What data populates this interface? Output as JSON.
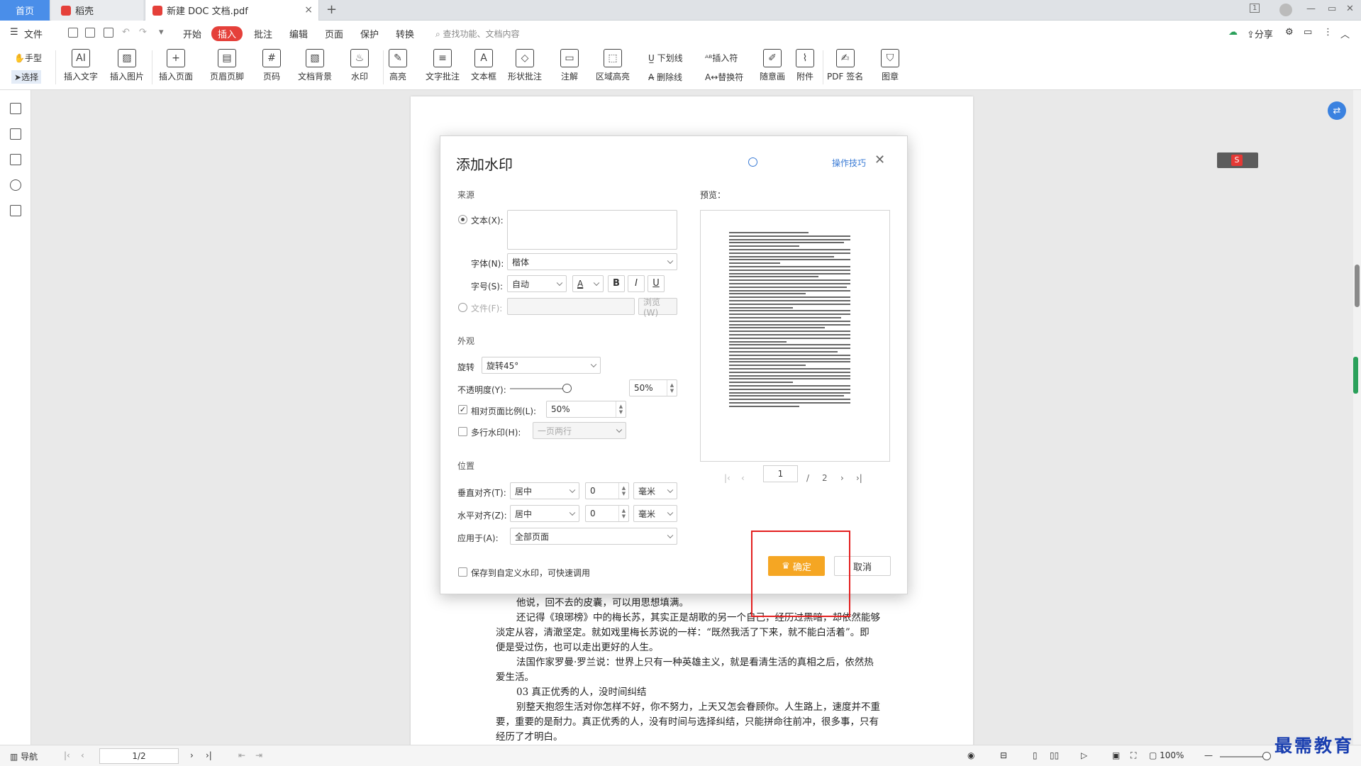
{
  "tabs": {
    "home": "首页",
    "daoke": "稻壳",
    "doc": "新建 DOC 文档.pdf",
    "close": "×",
    "plus": "+"
  },
  "window": {
    "pageview": "1",
    "minimize": "—",
    "restore": "▭",
    "close": "✕"
  },
  "menu": {
    "file": "文件",
    "items": [
      "开始",
      "插入",
      "批注",
      "编辑",
      "页面",
      "保护",
      "转换"
    ],
    "search_placeholder": "查找功能、文档内容",
    "share": "分享"
  },
  "ribbon": {
    "hand": "手型",
    "select": "选择",
    "buttons": [
      "插入文字",
      "插入图片",
      "插入页面",
      "页眉页脚",
      "页码",
      "文档背景",
      "水印",
      "高亮",
      "文字批注",
      "文本框",
      "形状批注",
      "注解",
      "区域高亮"
    ],
    "underline": "下划线",
    "strike": "删除线",
    "insert_char": "插入符",
    "replace_char": "替换符",
    "freehand": "随意画",
    "attach": "附件",
    "pdf_sign": "PDF 签名",
    "stamp": "图章"
  },
  "doc_lines": [
    "他说，回不去的皮囊，可以用思想填满。",
    "还记得《琅琊榜》中的梅长苏，其实正是胡歌的另一个自己，经历过黑暗，却依然能够",
    "淡定从容，清澈坚定。就如戏里梅长苏说的一样：“既然我活了下来，就不能白活着”。即",
    "便是受过伤，也可以走出更好的人生。",
    "法国作家罗曼·罗兰说：世界上只有一种英雄主义，就是看清生活的真相之后，依然热",
    "爱生活。",
    "03  真正优秀的人，没时间纠结",
    "别整天抱怨生活对你怎样不好，你不努力，上天又怎会眷顾你。人生路上，速度并不重",
    "要，重要的是耐力。真正优秀的人，没有时间与选择纠结，只能拼命往前冲，很多事，只有",
    "经历了才明白。"
  ],
  "dialog": {
    "title": "添加水印",
    "tips": "操作技巧",
    "source": "来源",
    "text_label": "文本(X):",
    "text_value": "",
    "font_label": "字体(N):",
    "font_value": "楷体",
    "size_label": "字号(S):",
    "size_value": "自动",
    "font_color_glyph": "A",
    "bold": "B",
    "italic": "I",
    "underline": "U",
    "file_label": "文件(F):",
    "browse": "浏览(W)",
    "appearance": "外观",
    "rotate_label": "旋转",
    "rotate_value": "旋转45°",
    "opacity_label": "不透明度(Y):",
    "opacity_value": "50%",
    "opacity": 0.5,
    "relative_label": "相对页面比例(L):",
    "relative_value": "50%",
    "multi_label": "多行水印(H):",
    "multi_value": "一页两行",
    "position": "位置",
    "valign_label": "垂直对齐(T):",
    "valign_value": "居中",
    "valign_offset": "0",
    "valign_unit": "毫米",
    "halign_label": "水平对齐(Z):",
    "halign_value": "居中",
    "halign_offset": "0",
    "halign_unit": "毫米",
    "apply_label": "应用于(A):",
    "apply_value": "全部页面",
    "save_custom": "保存到自定义水印，可快速调用",
    "preview_label": "预览：",
    "page_current": "1",
    "page_sep": "/",
    "page_total": "2",
    "ok": "确定",
    "cancel": "取消"
  },
  "status": {
    "nav": "导航",
    "page": "1/2",
    "zoom": "100%"
  },
  "brand": "最需教育",
  "colors": {
    "accent_red": "#e5403a",
    "ok_orange": "#f5a623",
    "home_blue": "#4a8ee9",
    "highlight": "#e31f1f"
  }
}
